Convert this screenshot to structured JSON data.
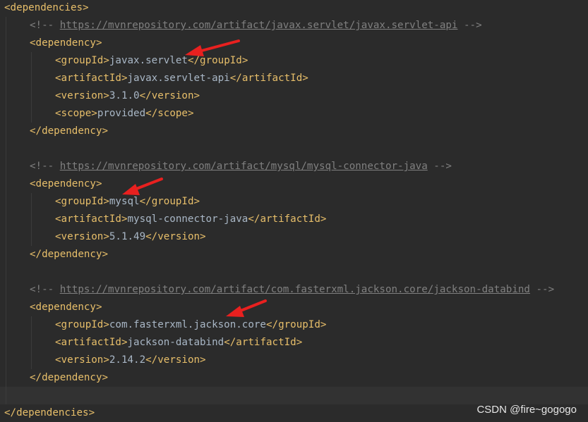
{
  "lines": [
    {
      "kind": "open",
      "tag": "dependencies",
      "indent": 0
    },
    {
      "kind": "comment",
      "indent": 1,
      "url": "https://mvnrepository.com/artifact/javax.servlet/javax.servlet-api"
    },
    {
      "kind": "open",
      "tag": "dependency",
      "indent": 1
    },
    {
      "kind": "element",
      "tag": "groupId",
      "value": "javax.servlet",
      "indent": 2
    },
    {
      "kind": "element",
      "tag": "artifactId",
      "value": "javax.servlet-api",
      "indent": 2
    },
    {
      "kind": "element",
      "tag": "version",
      "value": "3.1.0",
      "indent": 2
    },
    {
      "kind": "element",
      "tag": "scope",
      "value": "provided",
      "indent": 2
    },
    {
      "kind": "close",
      "tag": "dependency",
      "indent": 1
    },
    {
      "kind": "blank",
      "indent": 1
    },
    {
      "kind": "comment",
      "indent": 1,
      "url": "https://mvnrepository.com/artifact/mysql/mysql-connector-java"
    },
    {
      "kind": "open",
      "tag": "dependency",
      "indent": 1
    },
    {
      "kind": "element",
      "tag": "groupId",
      "value": "mysql",
      "indent": 2
    },
    {
      "kind": "element",
      "tag": "artifactId",
      "value": "mysql-connector-java",
      "indent": 2
    },
    {
      "kind": "element",
      "tag": "version",
      "value": "5.1.49",
      "indent": 2
    },
    {
      "kind": "close",
      "tag": "dependency",
      "indent": 1
    },
    {
      "kind": "blank",
      "indent": 1
    },
    {
      "kind": "comment",
      "indent": 1,
      "url": "https://mvnrepository.com/artifact/com.fasterxml.jackson.core/jackson-databind"
    },
    {
      "kind": "open",
      "tag": "dependency",
      "indent": 1
    },
    {
      "kind": "element",
      "tag": "groupId",
      "value": "com.fasterxml.jackson.core",
      "indent": 2
    },
    {
      "kind": "element",
      "tag": "artifactId",
      "value": "jackson-databind",
      "indent": 2
    },
    {
      "kind": "element",
      "tag": "version",
      "value": "2.14.2",
      "indent": 2
    },
    {
      "kind": "close",
      "tag": "dependency",
      "indent": 1
    },
    {
      "kind": "blank",
      "indent": 1,
      "current": true
    },
    {
      "kind": "close",
      "tag": "dependencies",
      "indent": 0
    }
  ],
  "watermark": "CSDN @fire~gogogo",
  "colors": {
    "background": "#2b2b2b",
    "tag": "#e8bf6a",
    "text": "#a9b7c6",
    "comment": "#808080",
    "arrow": "#e8201f"
  }
}
